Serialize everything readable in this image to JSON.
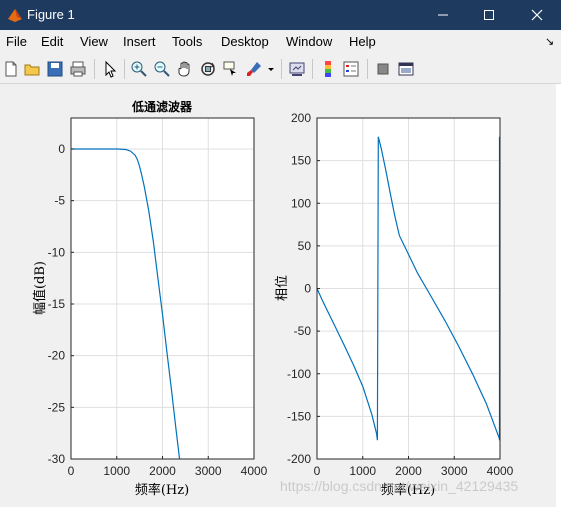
{
  "window": {
    "title": "Figure 1"
  },
  "menu": {
    "items": [
      "File",
      "Edit",
      "View",
      "Insert",
      "Tools",
      "Desktop",
      "Window",
      "Help"
    ],
    "more": "↘"
  },
  "toolbar": {
    "icons": [
      "new-figure-icon",
      "open-file-icon",
      "save-icon",
      "print-icon",
      "edit-plot-arrow-icon",
      "zoom-in-icon",
      "zoom-out-icon",
      "pan-hand-icon",
      "rotate-3d-icon",
      "data-cursor-icon",
      "brush-icon",
      "brush-dropdown-icon",
      "link-plot-icon",
      "colorbar-icon",
      "legend-icon",
      "hide-plot-tools-icon",
      "show-plot-tools-icon"
    ]
  },
  "watermark": "https://blog.csdn.net/weixin_42129435",
  "chart_data": [
    {
      "type": "line",
      "title": "低通滤波器",
      "xlabel": "频率(Hz)",
      "ylabel": "幅值(dB)",
      "xlim": [
        0,
        4000
      ],
      "ylim": [
        -30,
        3
      ],
      "xticks": [
        0,
        1000,
        2000,
        3000,
        4000
      ],
      "yticks": [
        0,
        -5,
        -10,
        -15,
        -20,
        -25,
        -30
      ],
      "grid": true,
      "series": [
        {
          "color": "#0072bd",
          "x": [
            0,
            500,
            1000,
            1200,
            1300,
            1400,
            1450,
            1500,
            1550,
            1600,
            1700,
            1800,
            1900,
            2000,
            2100,
            2200,
            2300,
            2400
          ],
          "y": [
            0,
            0,
            0,
            -0.05,
            -0.2,
            -0.6,
            -1,
            -1.7,
            -2.6,
            -3.6,
            -6,
            -9,
            -12.5,
            -16,
            -19.8,
            -23.5,
            -27.3,
            -31
          ]
        }
      ]
    },
    {
      "type": "line",
      "title": "",
      "xlabel": "频率(Hz)",
      "ylabel": "相位",
      "xlim": [
        0,
        4000
      ],
      "ylim": [
        -200,
        200
      ],
      "xticks": [
        0,
        1000,
        2000,
        3000,
        4000
      ],
      "yticks": [
        200,
        150,
        100,
        50,
        0,
        -50,
        -100,
        -150,
        -200
      ],
      "grid": true,
      "series": [
        {
          "color": "#0072bd",
          "x": [
            0,
            100,
            200,
            400,
            600,
            800,
            1000,
            1200,
            1300,
            1320,
            1340,
            1400,
            1500,
            1600,
            1700,
            1800,
            2000,
            2200,
            2500,
            2800,
            3100,
            3400,
            3700,
            4000
          ],
          "y": [
            0,
            -12,
            -23,
            -45,
            -67,
            -90,
            -115,
            -148,
            -170,
            -178,
            178,
            165,
            140,
            112,
            85,
            62,
            40,
            18,
            -10,
            -38,
            -68,
            -100,
            -135,
            -178
          ]
        },
        {
          "color": "#0072bd",
          "x": [
            3990,
            3990
          ],
          "y": [
            -178,
            178
          ]
        }
      ]
    }
  ]
}
